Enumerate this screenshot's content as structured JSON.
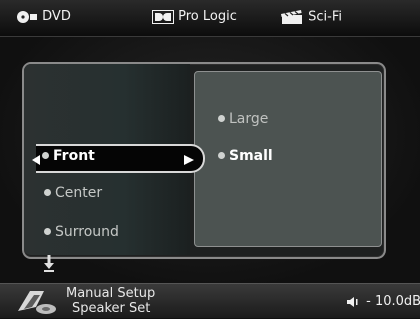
{
  "header": {
    "source": "DVD",
    "mode": "Pro Logic",
    "genre": "Sci-Fi",
    "source_icon": "disc-icon",
    "mode_icon": "dolby-logo-icon",
    "genre_icon": "clapperboard-icon"
  },
  "menu": {
    "items": [
      {
        "label": "Front",
        "selected": true
      },
      {
        "label": "Center",
        "selected": false
      },
      {
        "label": "Surround",
        "selected": false
      }
    ],
    "options": [
      {
        "label": "Large",
        "selected": false
      },
      {
        "label": "Small",
        "selected": true
      }
    ]
  },
  "footer": {
    "line1": "Manual Setup",
    "line2": "Speaker Set",
    "volume": "- 10.0dB",
    "footer_icon": "speaker-setup-icon",
    "volume_icon": "speaker-volume-icon"
  },
  "colors": {
    "background": "#101010",
    "panel_right": "#4c5351",
    "highlight_border": "#d8d8d8",
    "text": "#e6e6e6"
  }
}
